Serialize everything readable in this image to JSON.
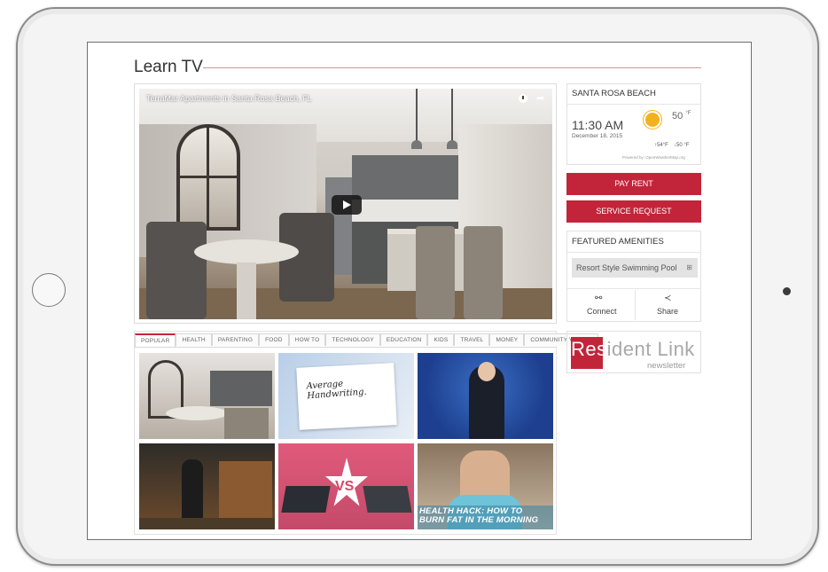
{
  "page": {
    "title": "Learn TV"
  },
  "video": {
    "caption": "TerraMar Apartments in Santa Rosa Beach, FL"
  },
  "tabs": [
    {
      "label": "POPULAR"
    },
    {
      "label": "HEALTH"
    },
    {
      "label": "PARENTING"
    },
    {
      "label": "FOOD"
    },
    {
      "label": "HOW TO"
    },
    {
      "label": "TECHNOLOGY"
    },
    {
      "label": "EDUCATION"
    },
    {
      "label": "KIDS"
    },
    {
      "label": "TRAVEL"
    },
    {
      "label": "MONEY"
    },
    {
      "label": "COMMUNITY VIDEOS"
    }
  ],
  "thumbnails": {
    "t2_text_line1": "Average",
    "t2_text_line2": "Handwriting.",
    "t5_text": "VS",
    "t6_line1": "HEALTH HACK: HOW TO",
    "t6_line2": "BURN FAT IN THE MORNING"
  },
  "weather": {
    "city": "SANTA ROSA BEACH",
    "time": "11:30 AM",
    "date": "December 18, 2015",
    "temp": "50",
    "temp_unit": "°F",
    "high": "54°F",
    "low": "50 °F",
    "powered": "Powered by: OpenWeatherMap.org"
  },
  "buttons": {
    "pay_rent": "PAY RENT",
    "service_request": "SERVICE REQUEST"
  },
  "amenities": {
    "title": "FEATURED AMENITIES",
    "item": "Resort Style Swimming Pool",
    "item_icon": "⊞",
    "connect": "Connect",
    "share": "Share",
    "connect_icon": "⚯",
    "share_icon": "≺"
  },
  "resident_link": {
    "res": "Res",
    "ident_link": "ident Link",
    "sub": "newsletter"
  },
  "colors": {
    "accent": "#c2253a",
    "weather_sun": "#f2b21f"
  }
}
